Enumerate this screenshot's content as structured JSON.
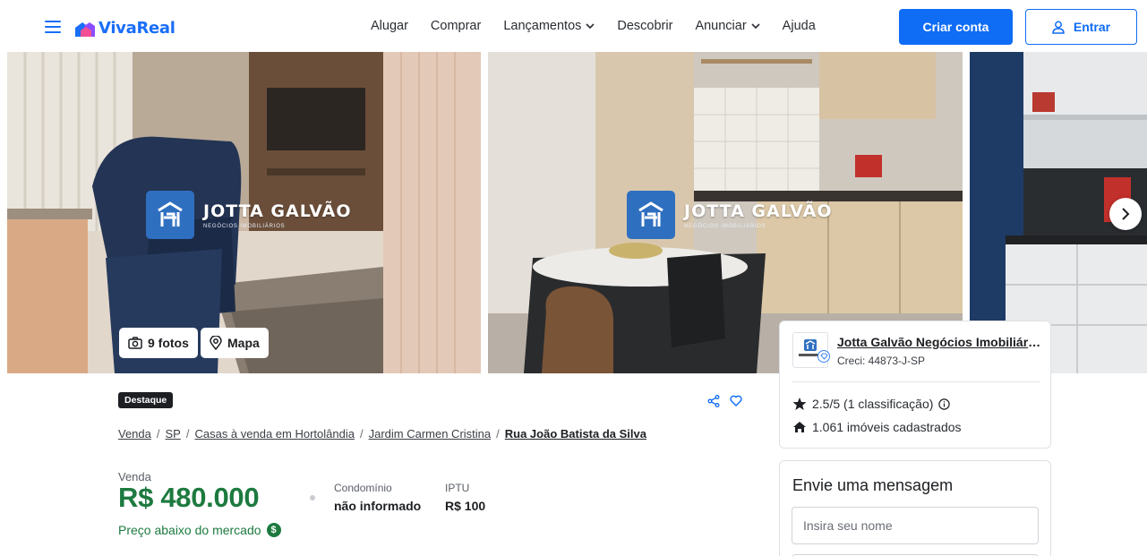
{
  "header": {
    "logo_text": "VivaReal",
    "nav": [
      "Alugar",
      "Comprar",
      "Lançamentos",
      "Descobrir",
      "Anunciar",
      "Ajuda"
    ],
    "create_account": "Criar conta",
    "login": "Entrar",
    "brand_color": "#0f6cf5"
  },
  "gallery": {
    "watermark_title": "JOTTA GALVÃO",
    "watermark_subtitle": "NEGÓCIOS IMOBILIÁRIOS",
    "photos_chip": "9 fotos",
    "map_chip": "Mapa"
  },
  "listing": {
    "badge": "Destaque",
    "breadcrumb": [
      "Venda",
      "SP",
      "Casas à venda em Hortolândia",
      "Jardim Carmen Cristina",
      "Rua João Batista da Silva"
    ],
    "price_label": "Venda",
    "price": "R$ 480.000",
    "condo_label": "Condomínio",
    "condo_value": "não informado",
    "iptu_label": "IPTU",
    "iptu_value": "R$ 100",
    "below_market": "Preço abaixo do mercado",
    "price_color": "#1d7a3f"
  },
  "agent": {
    "name": "Jotta Galvão Negócios Imobiliários",
    "creci": "Creci: 44873-J-SP",
    "rating": "2.5/5 (1 classificação)",
    "listings": "1.061 imóveis cadastrados"
  },
  "message": {
    "title": "Envie uma mensagem",
    "name_placeholder": "Insira seu nome"
  },
  "icons": [
    "menu-icon",
    "camera-icon",
    "map-pin-icon",
    "chevron-right-icon",
    "share-icon",
    "heart-icon",
    "star-icon",
    "info-icon",
    "house-icon",
    "user-icon",
    "dollar-icon",
    "verified-icon"
  ]
}
